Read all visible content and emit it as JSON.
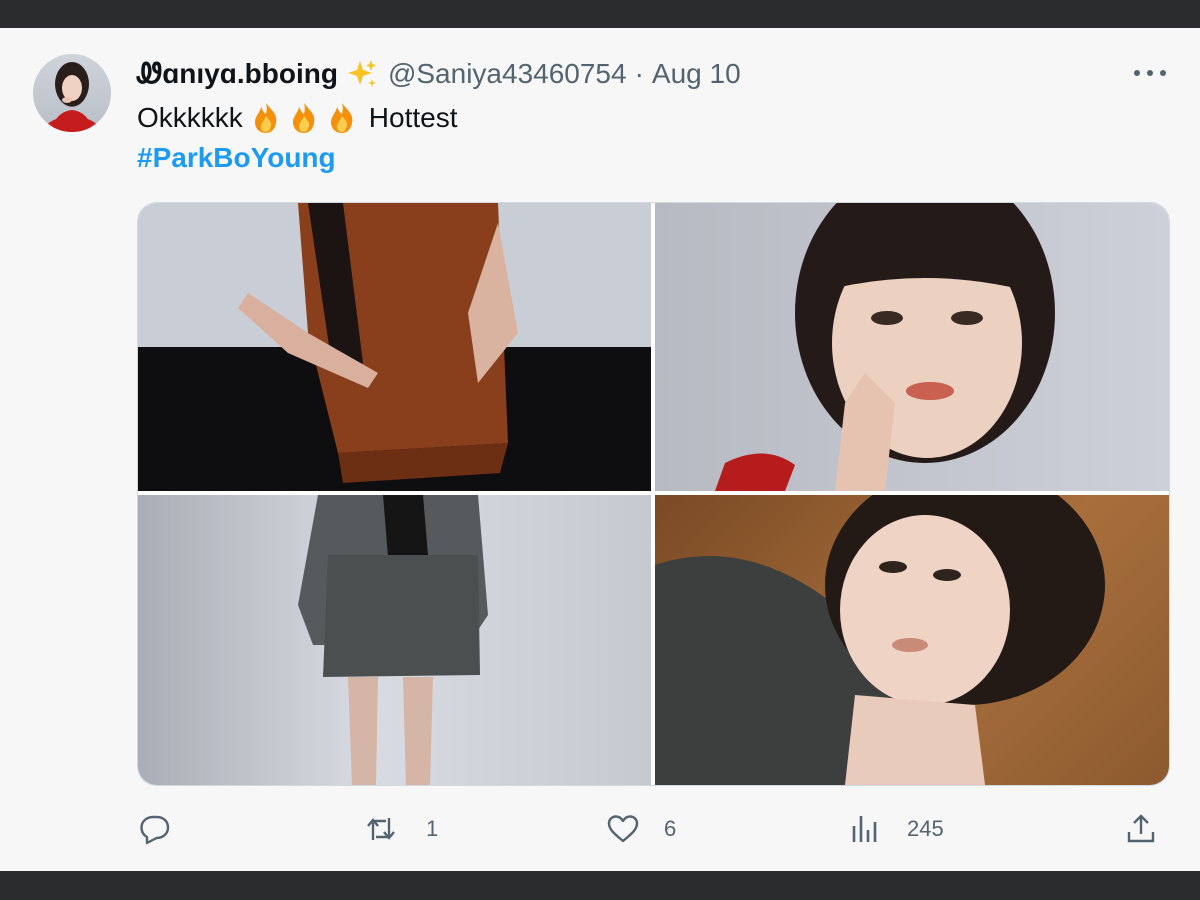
{
  "tweet": {
    "display_name": "Ꮺɑnıyɑ.bboing",
    "handle": "@Saniya43460754",
    "separator": "·",
    "date": "Aug 10",
    "text_before": "Okkkkkk",
    "text_after": "Hottest",
    "hashtag": "#ParkBoYoung",
    "emoji_icons": [
      "sparkles-icon",
      "fire-icon",
      "fire-icon",
      "fire-icon"
    ]
  },
  "actions": {
    "reply_count": "",
    "retweet_count": "1",
    "like_count": "6",
    "views_count": "245"
  },
  "colors": {
    "link": "#1d9bf0",
    "muted": "#536471",
    "frame": "#2b2c2e"
  }
}
